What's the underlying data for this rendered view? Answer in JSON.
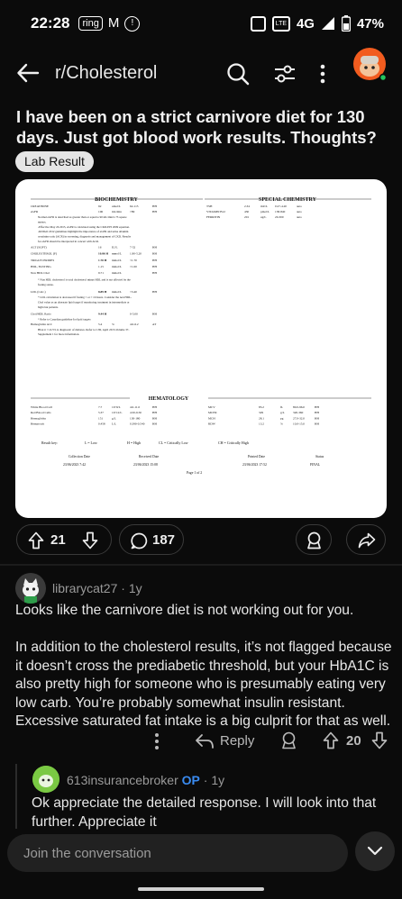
{
  "status_bar": {
    "time": "22:28",
    "network": "4G",
    "battery": "47%"
  },
  "header": {
    "subreddit": "r/Cholesterol"
  },
  "post": {
    "title": "I have been on a strict carnivore diet for 130 days. Just got blood work results. Thoughts?",
    "flair": "Lab Result",
    "upvotes": "21",
    "comments": "187"
  },
  "lab_report": {
    "biochem_title": "BIOCHEMISTRY",
    "special_title": "SPECIAL CHEMISTRY",
    "hem_title": "HEMATOLOGY",
    "biochem_rows": [
      [
        "CREATININE",
        "92",
        "umol/L",
        "62-115",
        "HH"
      ],
      [
        "eGFR",
        "106",
        "mL/min",
        ">89",
        "HH"
      ]
    ],
    "egfr_notes": [
      "Normal eGFR is described as greater than or equal to 90 mL/min/1.73 square",
      "meters.",
      "-Effective May 26 2015, eGFR is calculated using the CKD-EPI 2009 equation.",
      "-KDIGO 2012 guidelines highlight the importance of eGFR and urine albumin",
      "creatinine ratio (ACR) in screening, diagnosis and management of CKD. Results",
      "for eGFR should be interpreted in concert with ACR."
    ],
    "lipid_rows": [
      [
        "ALT (SGPT)",
        "16",
        "IU/L",
        "7-52",
        "HH"
      ],
      [
        "CHOLESTEROL (F)",
        "10.86 H",
        "mmol/L",
        "1.90-5.20",
        "HH"
      ],
      [
        "TRIGLYCERIDES",
        "1.70 H",
        "mmol/L",
        "<1.70",
        "HH"
      ],
      [
        "HDL, FASTING",
        "1.15",
        "mmol/L",
        ">1.00",
        "HH"
      ],
      [
        "Non HDL Chol",
        "9.71",
        "mmol/L",
        "",
        "HH"
      ]
    ],
    "nonhdl_notes": [
      "* Non HDL cholesterol is total cholesterol minus HDL and is not affected by the",
      "fasting status."
    ],
    "ldl_row": [
      "LDL (Calc.)",
      "8.89 H",
      "mmol/L",
      "<3.40",
      "HH"
    ],
    "ldl_notes": [
      "* LDL calculation is decreased if fasting < or > 16 hours. Consider the non HDL-",
      "Chol value as an alternate lipid target if monitoring treatment in intermediate or",
      "high risk patients."
    ],
    "ratio_row": [
      "Chol/HDL Ratio",
      "9.44 H",
      "",
      "0-5.00",
      "HH"
    ],
    "ratio_notes": [
      "* Refer to Canadian guideline for lipid targets"
    ],
    "a1c_row": [
      "Hemoglobin A1C",
      "5.4",
      "%",
      "4.0-6.2",
      "AT"
    ],
    "a1c_notes": [
      "HbA1c >=6.5% is diagnostic of diabetes. Refer to CJD, April 2013-Volume 37-",
      "Supplement 1 for more information."
    ],
    "special_rows": [
      [
        "TSH",
        "2.34",
        "mU/L",
        "0.27-4.20",
        "auto"
      ],
      [
        "VITAMIN B12",
        "430",
        "pmol/L",
        "138-840",
        "auto"
      ],
      [
        "FERRITIN",
        "201",
        "ug/L",
        "20-300",
        "auto"
      ]
    ],
    "hem_left": [
      [
        "White Blood Cell",
        "7.7",
        "10^9/L",
        "4.0-11.0",
        "HH"
      ],
      [
        "Red Blood Cells",
        "5.37",
        "10^12/L",
        "4.50-6.50",
        "HH"
      ],
      [
        "Hemoglobin",
        "151",
        "g/L",
        "130-180",
        "HH"
      ],
      [
        "Hematocrit",
        "0.458",
        "L/L",
        "0.390-0.540",
        "HH"
      ]
    ],
    "hem_right": [
      [
        "MCV",
        "85.2",
        "fL",
        "80.0-96.0",
        "HH"
      ],
      [
        "MCHC",
        "329",
        "g/L",
        "320-360",
        "HH"
      ],
      [
        "MCH",
        "28.1",
        "pg",
        "27.0-32.0",
        "HH"
      ],
      [
        "RDW",
        "13.2",
        "%",
        "10.0-15.0",
        "HH"
      ]
    ],
    "key": [
      "Result key:",
      "L = Low",
      "H = High",
      "CL = Critically Low",
      "CH = Critically High"
    ],
    "footer_headers": [
      "Collection Date",
      "Received Date",
      "Printed Date",
      "Status"
    ],
    "footer_values": [
      "23/06/2023   7:42",
      "23/06/2023   15:08",
      "23/06/2023   17:52",
      "FINAL"
    ],
    "page": "Page 1 of 2"
  },
  "comment1": {
    "username": "librarycat27",
    "age": "1y",
    "paragraph1": "Looks like the carnivore diet is not working out for you.",
    "paragraph2": "In addition to the cholesterol results, it’s not flagged because it doesn’t cross the prediabetic threshold, but your HbA1C is also pretty high for someone who is presumably eating very low carb. You’re probably somewhat insulin resistant. Excessive saturated fat intake is a big culprit for that as well.",
    "reply_label": "Reply",
    "votes": "20"
  },
  "comment2": {
    "username": "613insurancebroker",
    "op_badge": "OP",
    "age": "1y",
    "text": "Ok appreciate the detailed response. I will look into that further. Appreciate it"
  },
  "composer": {
    "placeholder": "Join the conversation"
  },
  "colors": {
    "background": "#0b0b0b",
    "op_blue": "#3a8bf0",
    "online_green": "#23c45e",
    "avatar_green": "#7ac943"
  }
}
